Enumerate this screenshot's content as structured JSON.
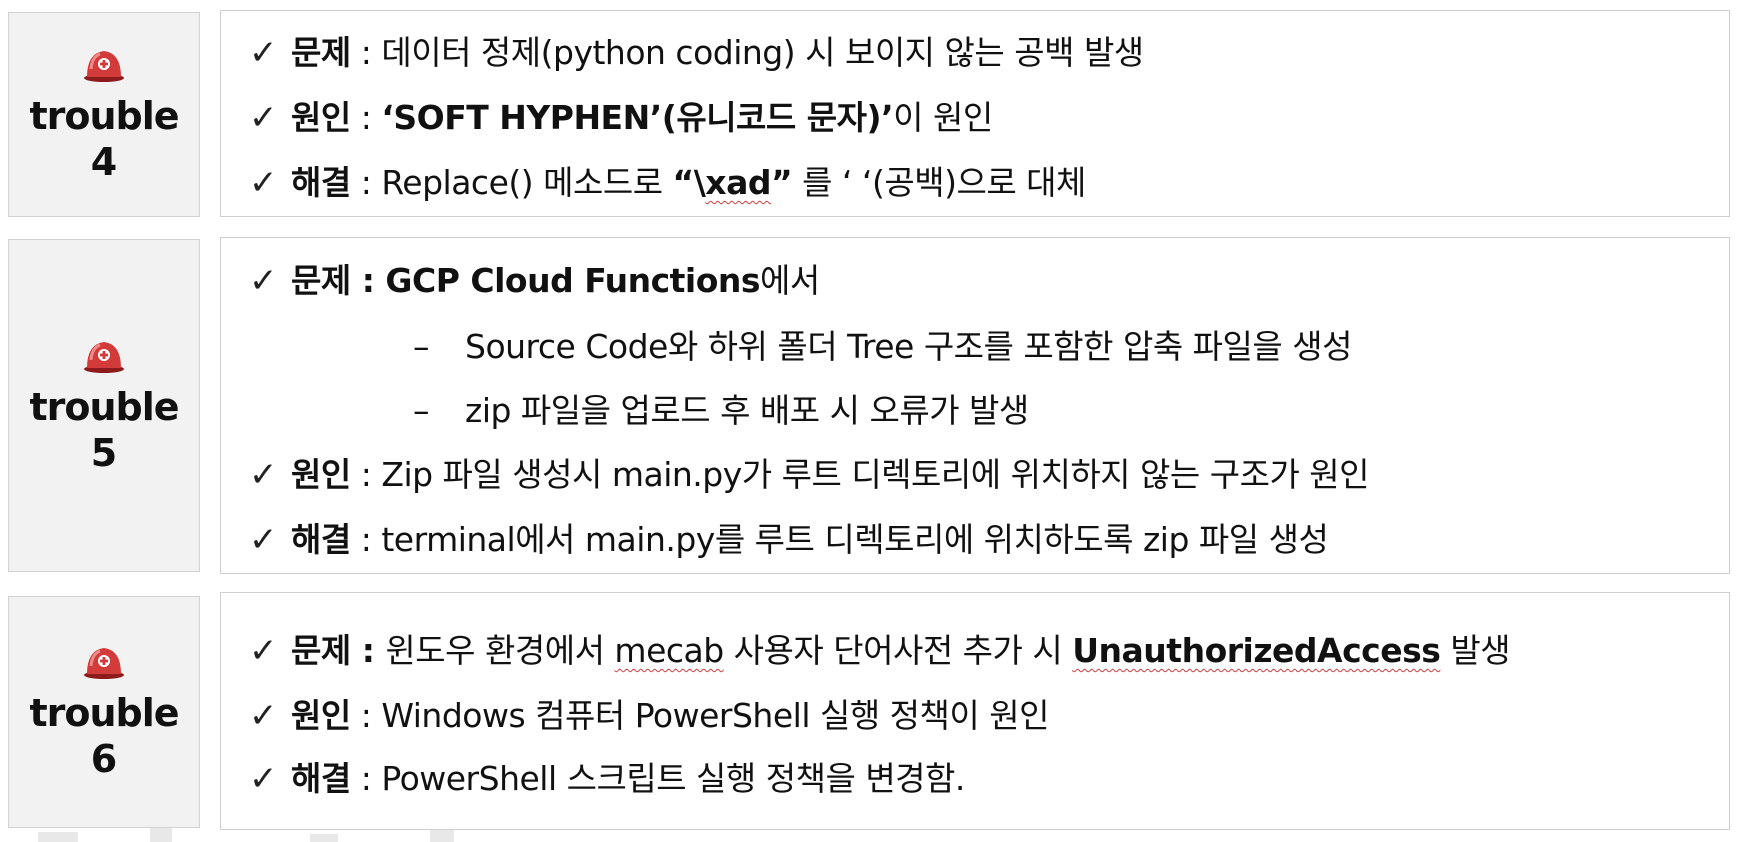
{
  "sections": [
    {
      "label_word": "trouble",
      "label_num": "4",
      "lines": {
        "problem_key": "문제",
        "problem_sep": " : ",
        "problem_text": "데이터 정제(python coding) 시 보이지 않는 공백 발생",
        "cause_key": "원인",
        "cause_sep": " : ",
        "cause_bold": "‘SOFT HYPHEN’(유니코드 문자)’",
        "cause_text": "이 원인",
        "fix_key": "해결",
        "fix_sep": " : ",
        "fix_pre": "Replace() 메소드로 ",
        "fix_q1": "“\\",
        "fix_xad": "xad",
        "fix_q2": "”",
        "fix_post": " 를 ‘  ‘(공백)으로 대체"
      }
    },
    {
      "label_word": "trouble",
      "label_num": "5",
      "lines": {
        "problem_key": "문제",
        "problem_sep": " : ",
        "problem_bold": "GCP Cloud Functions",
        "problem_text": "에서",
        "sub_dash": "–",
        "sub1": "Source Code와 하위 폴더 Tree 구조를 포함한 압축 파일을 생성",
        "sub2": "zip 파일을 업로드 후 배포 시 오류가 발생",
        "cause_key": "원인",
        "cause_sep": " : ",
        "cause_text": "Zip 파일 생성시 main.py가 루트 디렉토리에 위치하지 않는 구조가 원인",
        "fix_key": "해결",
        "fix_sep": " : ",
        "fix_text": "terminal에서 main.py를 루트 디렉토리에 위치하도록 zip 파일 생성"
      }
    },
    {
      "label_word": "trouble",
      "label_num": "6",
      "lines": {
        "problem_key": "문제",
        "problem_sep": " : ",
        "problem_pre": "윈도우 환경에서 ",
        "problem_mecab": "mecab",
        "problem_mid": " 사용자 단어사전 추가 시 ",
        "problem_bold": "UnauthorizedAccess",
        "problem_post": " 발생",
        "cause_key": "원인",
        "cause_sep": " : ",
        "cause_text": "Windows 컴퓨터 PowerShell 실행 정책이 원인",
        "fix_key": "해결",
        "fix_sep": " : ",
        "fix_text": "PowerShell 스크립트 실행 정책을 변경함."
      }
    }
  ],
  "check_mark": "✓",
  "icon": "hard-hat-icon"
}
